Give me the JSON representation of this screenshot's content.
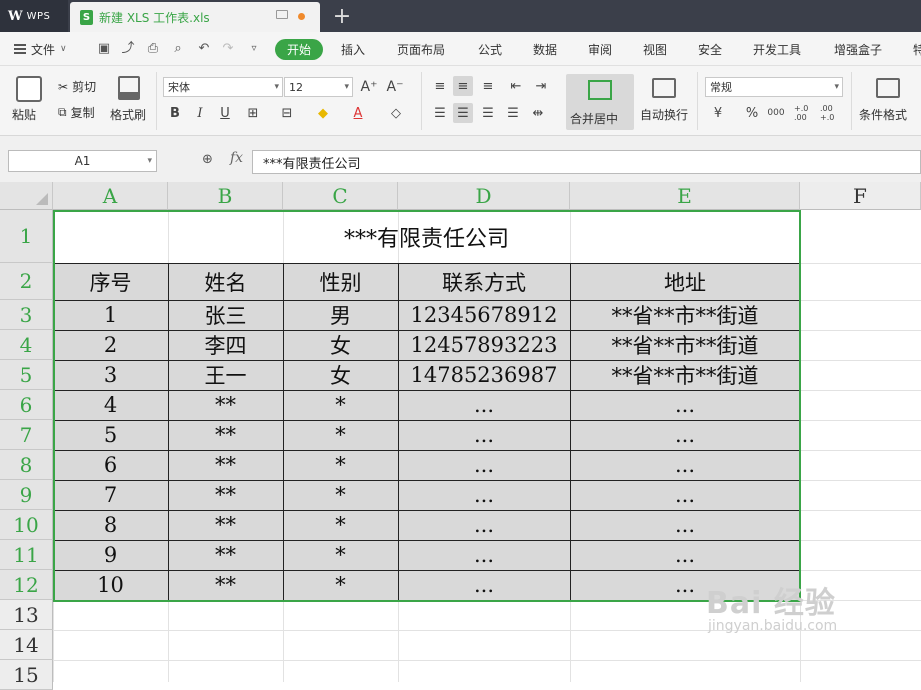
{
  "titlebar": {
    "app_name": "WPS",
    "doc_tab_icon": "S",
    "doc_tab_name": "新建 XLS 工作表.xls",
    "new_tab": "+"
  },
  "menubar": {
    "file_label": "文件",
    "items": [
      "开始",
      "插入",
      "页面布局",
      "公式",
      "数据",
      "审阅",
      "视图",
      "安全",
      "开发工具",
      "增强盒子",
      "特"
    ]
  },
  "ribbon": {
    "paste": "粘贴",
    "cut": "剪切",
    "copy": "复制",
    "format_painter": "格式刷",
    "font_name": "宋体",
    "font_size": "12",
    "grow_font": "A⁺",
    "shrink_font": "A⁻",
    "bold": "B",
    "italic": "I",
    "underline": "U",
    "merge_center": "合并居中",
    "wrap_text": "自动换行",
    "number_format": "常规",
    "currency": "¥",
    "percent": "%",
    "thousands": "000",
    "inc_decimal": "+.0 .00",
    "dec_decimal": ".00 +.0",
    "conditional_format": "条件格式"
  },
  "formula_bar": {
    "name_box": "A1",
    "fx": "fx",
    "content": "***有限责任公司"
  },
  "columns": [
    "A",
    "B",
    "C",
    "D",
    "E",
    "F"
  ],
  "rows": [
    "1",
    "2",
    "3",
    "4",
    "5",
    "6",
    "7",
    "8",
    "9",
    "10",
    "11",
    "12",
    "13",
    "14",
    "15"
  ],
  "sheet": {
    "title": "***有限责任公司",
    "headers": [
      "序号",
      "姓名",
      "性别",
      "联系方式",
      "地址"
    ],
    "data": [
      [
        "1",
        "张三",
        "男",
        "12345678912",
        "**省**市**街道"
      ],
      [
        "2",
        "李四",
        "女",
        "12457893223",
        "**省**市**街道"
      ],
      [
        "3",
        "王一",
        "女",
        "14785236987",
        "**省**市**街道"
      ],
      [
        "4",
        "**",
        "*",
        "...",
        "..."
      ],
      [
        "5",
        "**",
        "*",
        "...",
        "..."
      ],
      [
        "6",
        "**",
        "*",
        "...",
        "..."
      ],
      [
        "7",
        "**",
        "*",
        "...",
        "..."
      ],
      [
        "8",
        "**",
        "*",
        "...",
        "..."
      ],
      [
        "9",
        "**",
        "*",
        "...",
        "..."
      ],
      [
        "10",
        "**",
        "*",
        "...",
        "..."
      ]
    ]
  },
  "watermark": {
    "main": "Bai 经验",
    "sub": "jingyan.baidu.com"
  }
}
